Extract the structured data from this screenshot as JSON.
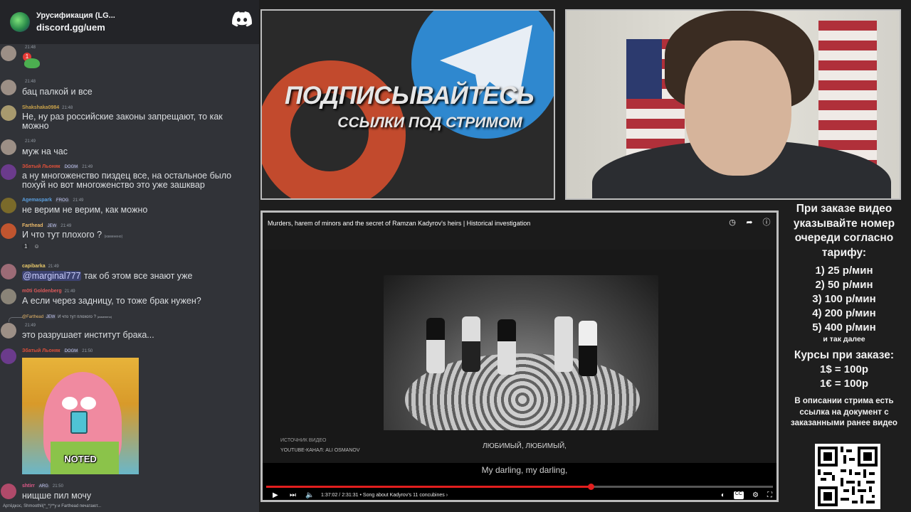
{
  "chat": {
    "server_name": "Урусификация (LG...",
    "invite_link": "discord.gg/uem",
    "messages": [
      {
        "user": "",
        "time": "21:48",
        "text": "",
        "extra": "1"
      },
      {
        "user": "",
        "time": "21:48",
        "text": "бац палкой и все"
      },
      {
        "user": "Shakshaka0984",
        "time": "21:48",
        "text": "Не, ну раз российские законы запрещают, то как можно"
      },
      {
        "user": "",
        "time": "21:49",
        "text": "муж на час"
      },
      {
        "user": "Збатый Льоняк",
        "badges": [
          "DOGM"
        ],
        "time": "21:49",
        "text": "а ну многоженство пиздец все, на остальное было похуй но вот многоженство это уже зашквар"
      },
      {
        "user": "Agemaspark",
        "badges": [
          "FROG"
        ],
        "time": "21:49",
        "text": "не верим не верим, как можно"
      },
      {
        "user": "Farthead",
        "badges": [
          "JEW"
        ],
        "time": "21:49",
        "text": "И что тут плохого ?",
        "edited": "(изменено)",
        "reactions": [
          "1"
        ]
      },
      {
        "user": "capibarka",
        "time": "21:49",
        "mention": "@marginal777",
        "text": " так об этом все знают уже"
      },
      {
        "user": "m0ti Goldenberg",
        "time": "21:49",
        "text": "А если через задницу, то тоже брак нужен?"
      },
      {
        "user": "",
        "time": "21:49",
        "reply_user": "@Farthead",
        "reply_badge": "JEW",
        "reply_text": "И что тут плохого ?",
        "reply_edited": "(изменено)",
        "text": "это разрушает институт брака..."
      },
      {
        "user": "Збатый Льоняк",
        "badges": [
          "DOGM"
        ],
        "time": "21:50",
        "image_caption": "NOTED"
      },
      {
        "user": "shtirr",
        "badges": [
          "ARG"
        ],
        "time": "21:50",
        "text": "нищше пил мочу"
      }
    ],
    "typing": "Артёдкос, Shmoothil(*_*)**у и Farthead печатают..."
  },
  "promo": {
    "title": "ПОДПИСЫВАЙТЕСЬ",
    "subtitle": "ССЫЛКИ ПОД СТРИМОМ"
  },
  "player": {
    "title": "Murders, harem of minors and the secret of Ramzan Kadyrov's heirs | Historical investigation",
    "source_label": "ИСТОЧНИК ВИДЕО",
    "source_channel": "YOUTUBE-КАНАЛ: ALI OSMANOV",
    "subtitle_ru": "ЛЮБИМЫЙ, ЛЮБИМЫЙ,",
    "subtitle_en": "My darling, my darling,",
    "time": "1:37:02 / 2:31:31",
    "chapter": "• Song about Kadyrov's 11 concubines",
    "progress": 0.64,
    "icons": {
      "watch_later": "clock-icon",
      "share": "share-icon",
      "info": "info-icon"
    }
  },
  "pricing": {
    "heading": "При заказе видео указывайте номер очереди согласно тарифу:",
    "tiers": [
      "1) 25 р/мин",
      "2) 50 р/мин",
      "3) 100 р/мин",
      "4) 200 р/мин",
      "5) 400 р/мин"
    ],
    "tiers_more": "и так далее",
    "courses_title": "Курсы при заказе:",
    "courses": [
      "1$ = 100р",
      "1€ = 100р"
    ],
    "doc_note": "В описании стрима есть ссылка на документ с заказанными ранее видео"
  },
  "colors": {
    "chat_bg": "#313338",
    "accent_red": "#e21e1e",
    "telegram_blue": "#2f88cf",
    "patreon_orange": "#c24a2d"
  }
}
